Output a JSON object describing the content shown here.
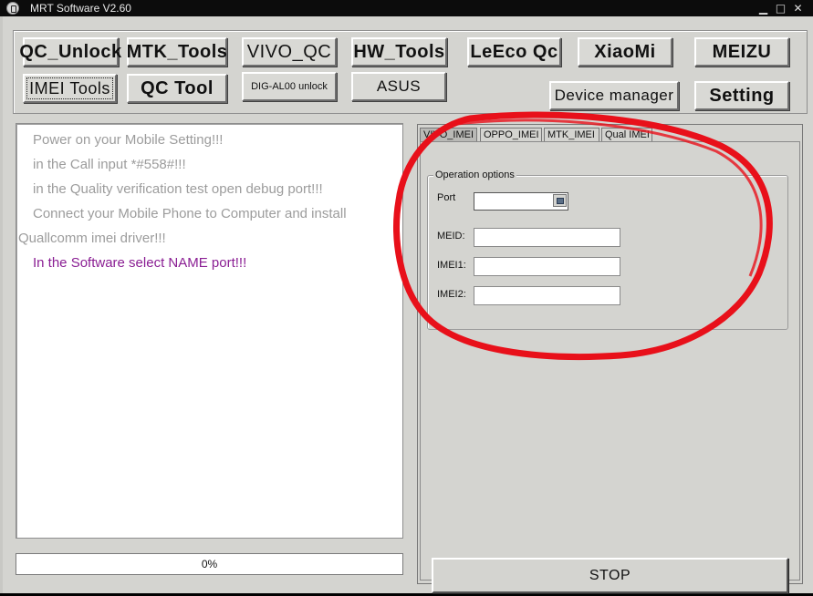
{
  "window": {
    "title": "MRT Software V2.60",
    "controls": {
      "minimize": "▁",
      "maximize": "□",
      "close": "✕"
    }
  },
  "toolbar": {
    "row1": [
      "QC_Unlock",
      "MTK_Tools",
      "VIVO_QC",
      "HW_Tools",
      "LeEco Qc",
      "XiaoMi",
      "MEIZU"
    ],
    "row2": [
      "IMEI Tools",
      "QC Tool",
      "DIG-AL00 unlock",
      "ASUS",
      "Device manager",
      "Setting"
    ]
  },
  "log": {
    "lines": [
      "Power on your Mobile Setting!!!",
      "in the Call input *#558#!!!",
      "in the Quality verification test open debug port!!!",
      "Connect your Mobile Phone to Computer and install",
      "Quallcomm imei driver!!!",
      "In the Software select NAME port!!!"
    ]
  },
  "progress": {
    "text": "0%",
    "value": 0
  },
  "tabs": [
    {
      "label": "VIVO_IMEI",
      "active": true
    },
    {
      "label": "OPPO_IMEI",
      "active": false
    },
    {
      "label": "MTK_IMEI",
      "active": false
    },
    {
      "label": "Qual IMEI",
      "active": false
    }
  ],
  "operation": {
    "legend": "Operation options",
    "port_label": "Port",
    "port_value": "",
    "meid_label": "MEID:",
    "meid_value": "",
    "imei1_label": "IMEI1:",
    "imei1_value": "",
    "imei2_label": "IMEI2:",
    "imei2_value": ""
  },
  "stop_label": "STOP",
  "colors": {
    "highlight_text": "#8a1e93",
    "dim_text": "#9c9c9c",
    "annotation": "#e8101a",
    "panel_bg": "#d4d4d0"
  }
}
